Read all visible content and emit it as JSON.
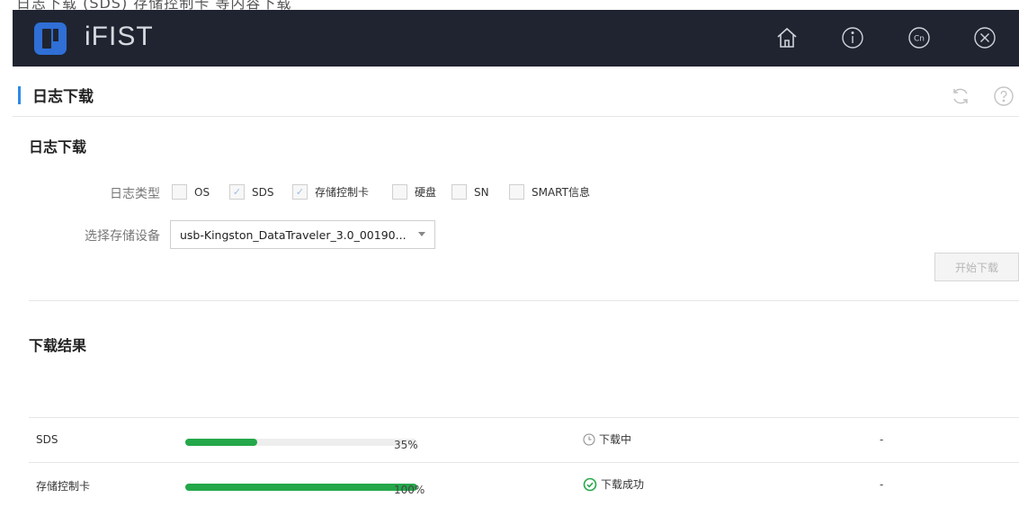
{
  "caption": "日志下载 (SDS) 存储控制卡 等内容下载",
  "header": {
    "app_name": "iFIST",
    "icons": [
      "home-icon",
      "info-icon",
      "language-cn-icon",
      "close-circle-icon"
    ],
    "lang_label": "Cn"
  },
  "titlebar": {
    "title": "日志下载",
    "icons": [
      "refresh-icon",
      "help-icon"
    ]
  },
  "log_download": {
    "heading": "日志下载",
    "log_type_label": "日志类型",
    "log_types": [
      {
        "label": "OS",
        "checked": false
      },
      {
        "label": "SDS",
        "checked": true
      },
      {
        "label": "存储控制卡",
        "checked": true
      },
      {
        "label": "硬盘",
        "checked": false
      },
      {
        "label": "SN",
        "checked": false
      },
      {
        "label": "SMART信息",
        "checked": false
      }
    ],
    "device_label": "选择存储设备",
    "device_selected": "usb-Kingston_DataTraveler_3.0_00190...",
    "start_button": "开始下载"
  },
  "results": {
    "heading": "下载结果",
    "rows": [
      {
        "name": "SDS",
        "progress": 35,
        "progress_label": "35%",
        "status": "下载中",
        "status_icon": "clock-icon",
        "extra": "-"
      },
      {
        "name": "存储控制卡",
        "progress": 100,
        "progress_label": "100%",
        "status": "下载成功",
        "status_icon": "check-circle-icon",
        "extra": "-"
      }
    ]
  },
  "colors": {
    "header_bg": "#1f2430",
    "accent_blue": "#2b8be6",
    "progress_green": "#24a84a",
    "success_green": "#24a84a"
  }
}
